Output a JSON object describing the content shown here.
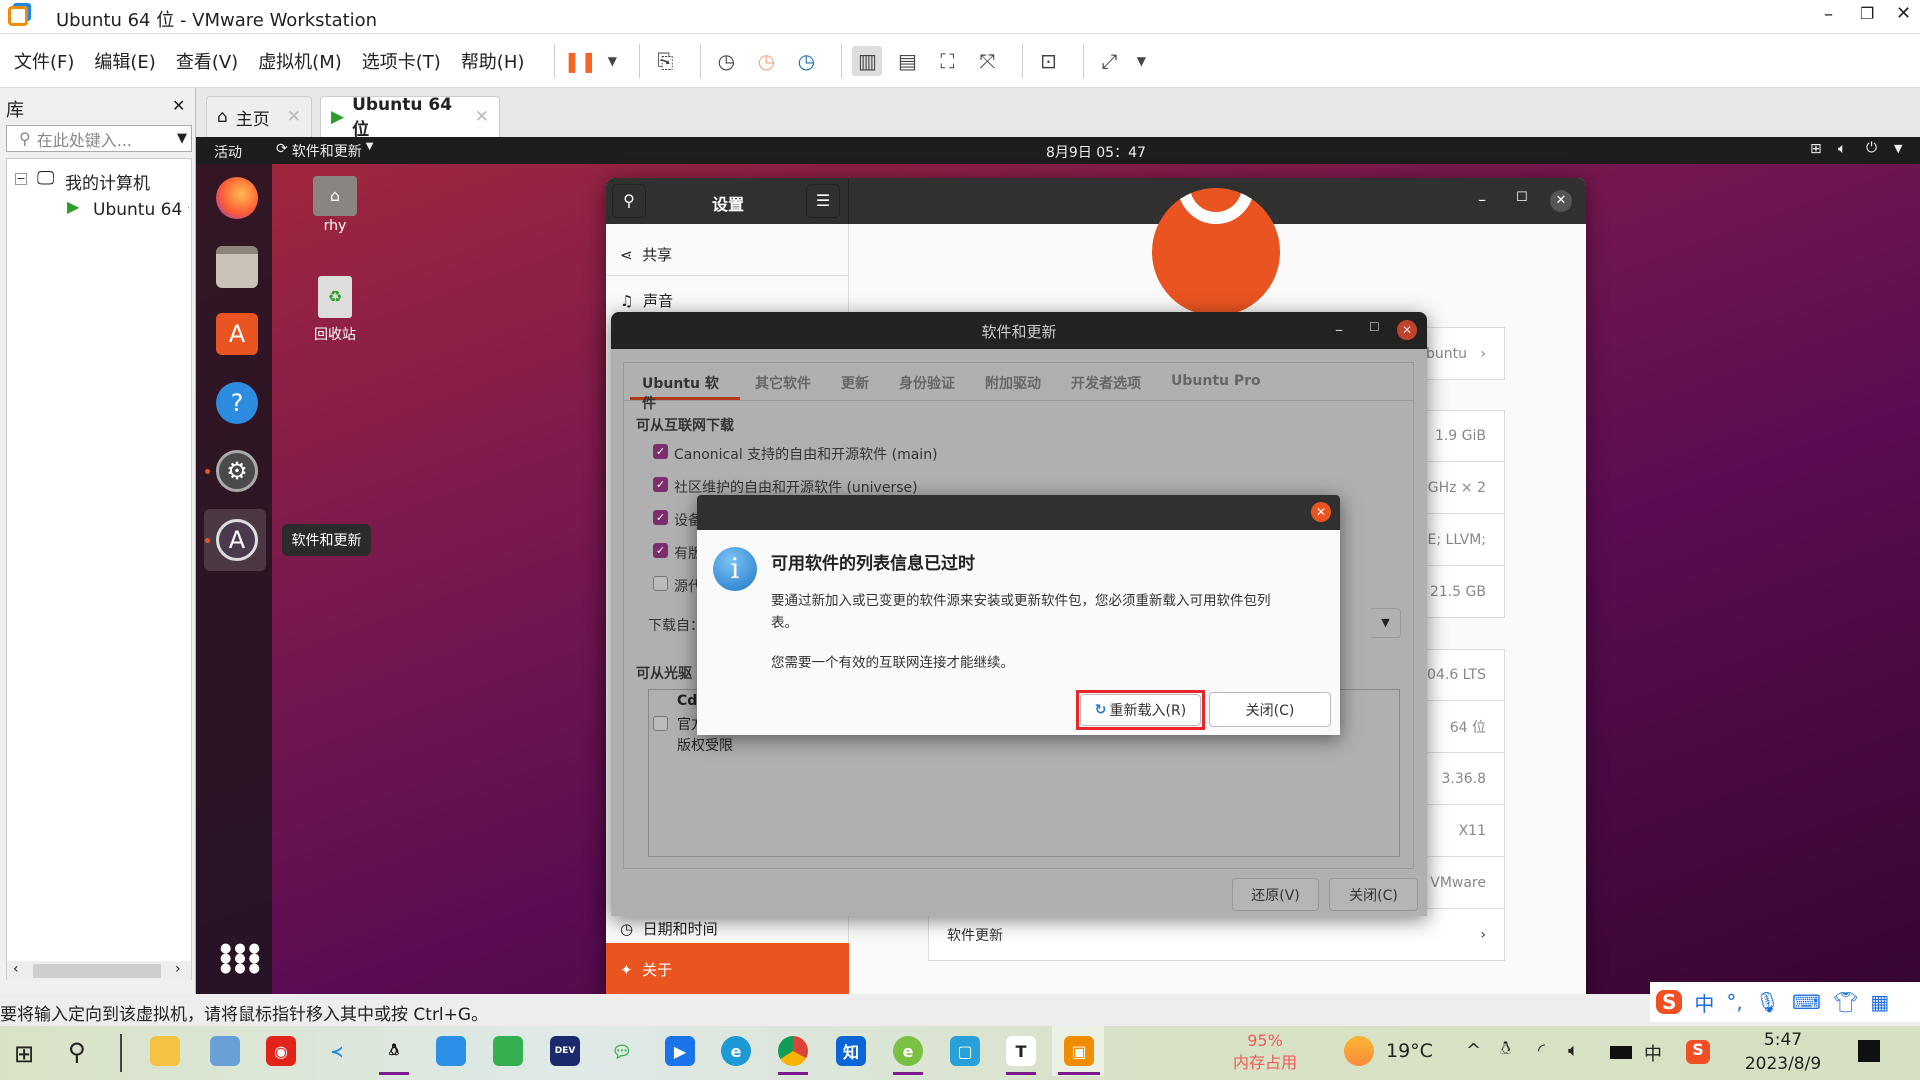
{
  "window": {
    "title": "Ubuntu 64 位 - VMware Workstation"
  },
  "menu": [
    "文件(F)",
    "编辑(E)",
    "查看(V)",
    "虚拟机(M)",
    "选项卡(T)",
    "帮助(H)"
  ],
  "library": {
    "title": "库",
    "search_placeholder": "在此处键入...",
    "tree_root": "我的计算机",
    "tree_vm": "Ubuntu 64 位"
  },
  "tabs": [
    {
      "label": "主页"
    },
    {
      "label": "Ubuntu 64 位"
    }
  ],
  "ubuntu_topbar": {
    "activities": "活动",
    "app_menu": "软件和更新",
    "clock": "8月9日 05：47"
  },
  "desktop": {
    "home_icon": "rhy",
    "trash_icon": "回收站",
    "dock_tooltip": "软件和更新"
  },
  "settings": {
    "title": "设置",
    "panel_title": "关于",
    "sidebar": [
      "共享",
      "声音",
      "日期和时间",
      "关于"
    ],
    "rows": {
      "device_name": "buntu",
      "memory": "1.9 GiB",
      "processor": "00GHz × 2",
      "graphics": "SE; LLVM;",
      "disk": "21.5 GB",
      "os_name": "0.04.6 LTS",
      "os_type": "64 位",
      "gnome": "3.36.8",
      "windowing": "X11",
      "virtualization": "VMware",
      "software_updates": "软件更新"
    }
  },
  "software_updates": {
    "title": "软件和更新",
    "tabs": [
      "Ubuntu 软件",
      "其它软件",
      "更新",
      "身份验证",
      "附加驱动",
      "开发者选项",
      "Ubuntu Pro"
    ],
    "active_tab": "Ubuntu 软件",
    "section_internet": "可从互联网下载",
    "options": [
      {
        "label": "Canonical 支持的自由和开源软件 (main)",
        "checked": true
      },
      {
        "label": "社区维护的自由和开源软件 (universe)",
        "checked": true
      },
      {
        "label": "设备",
        "checked": true
      },
      {
        "label": "有版",
        "checked": true
      },
      {
        "label": "源代",
        "checked": false
      }
    ],
    "download_from": "下载自：",
    "section_cdrom": "可从光驱",
    "cdrom": {
      "name": "Cd",
      "line1": "官方",
      "line2": "版权受限"
    },
    "revert_button": "还原(V)",
    "close_button": "关闭(C)"
  },
  "dialog": {
    "title": "可用软件的列表信息已过时",
    "body1": "要通过新加入或已变更的软件源来安装或更新软件包，您必须重新载入可用软件包列",
    "body1b": "表。",
    "body2": "您需要一个有效的互联网连接才能继续。",
    "reload_button": "重新载入(R)",
    "close_button": "关闭(C)",
    "highlight_color": "#e8262c"
  },
  "statusbar": {
    "text": "要将输入定向到该虚拟机，请将鼠标指针移入其中或按 Ctrl+G。"
  },
  "taskbar": {
    "memory_pct": "95%",
    "memory_label": "内存占用",
    "weather": "19°C",
    "ime": "中",
    "time": "5:47",
    "date": "2023/8/9"
  },
  "colors": {
    "ubuntu_orange": "#e95420",
    "checkbox": "#7b2d6d"
  }
}
